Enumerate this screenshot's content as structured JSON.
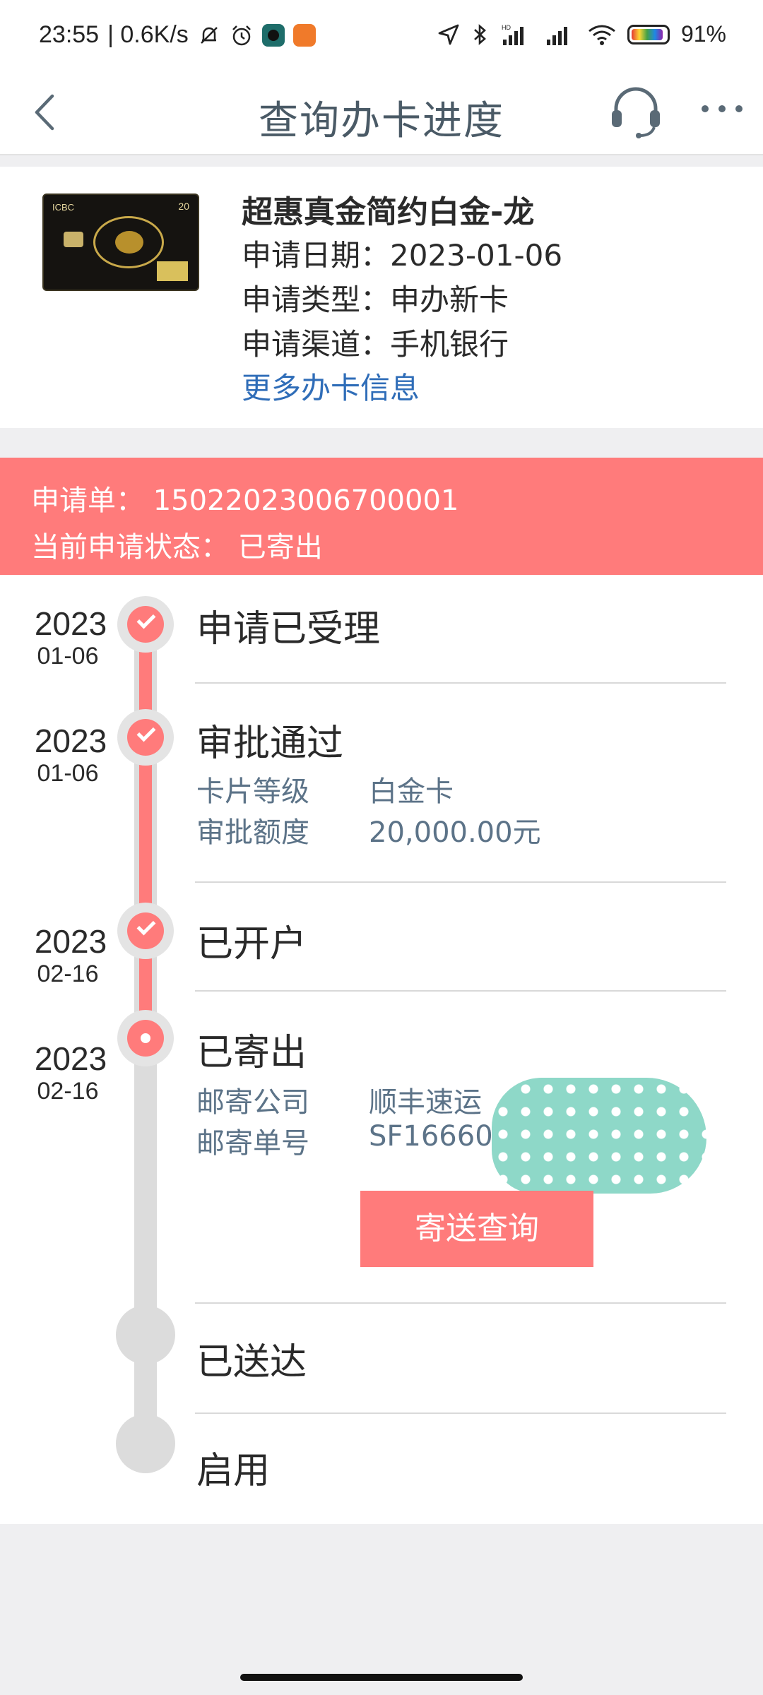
{
  "status_bar": {
    "time": "23:55",
    "speed": "| 0.6K/s",
    "battery": "91%",
    "battery_level": 0.91
  },
  "nav": {
    "title": "查询办卡进度",
    "icons": [
      "back-chevron-icon",
      "headset-icon",
      "more-dots-icon"
    ]
  },
  "card": {
    "name": "超惠真金简约白金-龙",
    "apply_date": "申请日期：2023-01-06",
    "apply_type": "申请类型：申办新卡",
    "apply_channel": "申请渠道：手机银行",
    "more_link": "更多办卡信息",
    "image_brand": "ICBC",
    "image_mark": "20"
  },
  "banner": {
    "order": "申请单：  15022023006700001",
    "status": "当前申请状态：  已寄出",
    "color": "#ff7b7b"
  },
  "timeline": {
    "steps": [
      {
        "year": "2023",
        "md": "01-06",
        "title": "申请已受理",
        "state": "done"
      },
      {
        "year": "2023",
        "md": "01-06",
        "title": "审批通过",
        "state": "done",
        "details": [
          {
            "label": "卡片等级",
            "value": "白金卡"
          },
          {
            "label": "审批额度",
            "value": "20,000.00元"
          }
        ]
      },
      {
        "year": "2023",
        "md": "02-16",
        "title": "已开户",
        "state": "done"
      },
      {
        "year": "2023",
        "md": "02-16",
        "title": "已寄出",
        "state": "current",
        "details": [
          {
            "label": "邮寄公司",
            "value": "顺丰速运"
          },
          {
            "label": "邮寄单号",
            "value": "SF16660"
          }
        ],
        "button": "寄送查询"
      },
      {
        "title": "已送达",
        "state": "pending"
      },
      {
        "title": "启用",
        "state": "pending"
      }
    ]
  }
}
